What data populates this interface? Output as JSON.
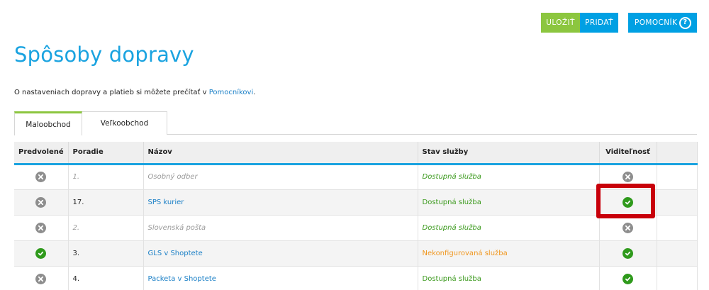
{
  "toolbar": {
    "save_label": "ULOŽIŤ",
    "add_label": "PRIDAŤ",
    "help_label": "POMOCNÍK",
    "help_icon": "?"
  },
  "page": {
    "title": "Spôsoby dopravy",
    "intro_text": "O nastaveniach dopravy a platieb si môžete prečítať v ",
    "intro_link": "Pomocníkovi",
    "intro_end": "."
  },
  "tabs": [
    {
      "label": "Maloobchod",
      "active": true
    },
    {
      "label": "Veľkoobchod",
      "active": false
    }
  ],
  "table": {
    "headers": {
      "default": "Predvolené",
      "order": "Poradie",
      "name": "Názov",
      "state": "Stav služby",
      "visibility": "Viditeľnosť"
    },
    "rows": [
      {
        "default": "x-icon",
        "order": "1.",
        "name": "Osobný odber",
        "state": "Dostupná služba",
        "visibility": "x-icon"
      },
      {
        "default": "x-icon",
        "order": "17.",
        "name": "SPS kurier",
        "state": "Dostupná služba",
        "visibility": "check-icon"
      },
      {
        "default": "x-icon",
        "order": "2.",
        "name": "Slovenská pošta",
        "state": "Dostupná služba",
        "visibility": "x-icon"
      },
      {
        "default": "check-icon",
        "order": "3.",
        "name": "GLS v Shoptete",
        "state": "Nekonfigurovaná služba",
        "visibility": "check-icon"
      },
      {
        "default": "x-icon",
        "order": "4.",
        "name": "Packeta v Shoptete",
        "state": "Dostupná služba",
        "visibility": "check-icon"
      }
    ]
  },
  "colors": {
    "accent_blue": "#1aa3e0",
    "save_green": "#8cc63f",
    "ok_green": "#3c9a1e",
    "warn_orange": "#f0961e",
    "highlight_red": "#c8000a"
  }
}
